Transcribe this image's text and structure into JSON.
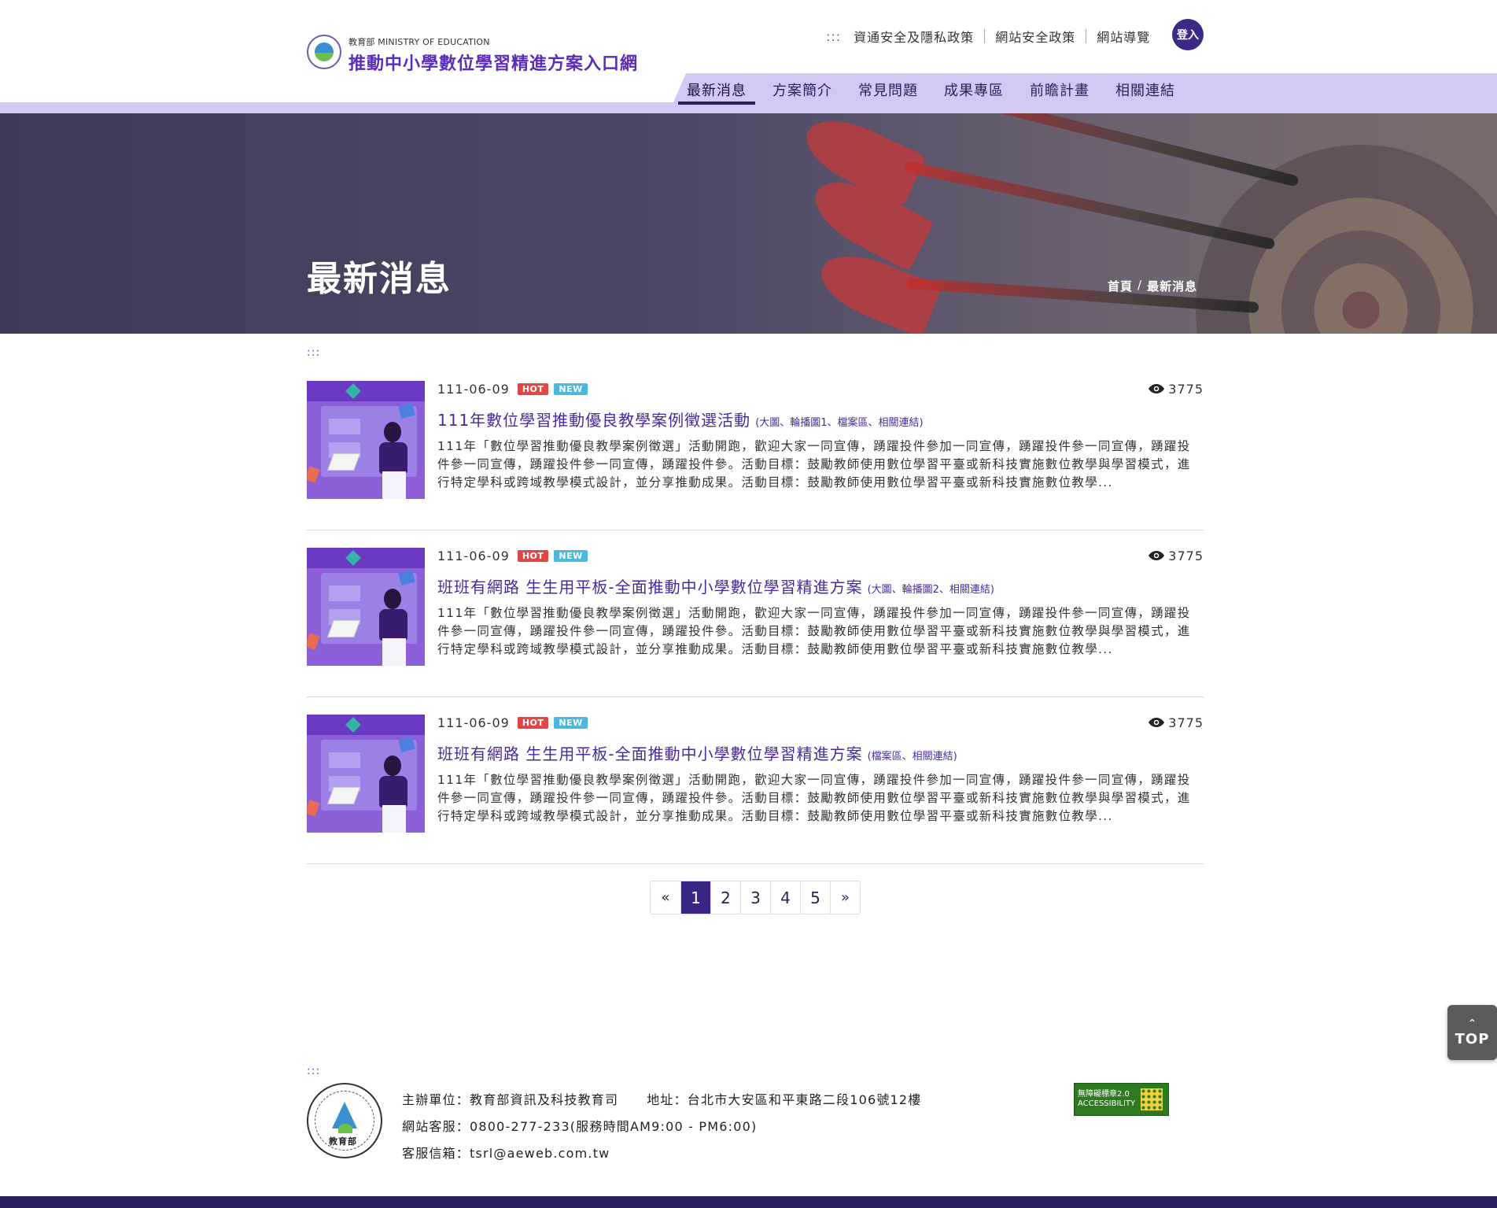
{
  "header": {
    "ministry": "教育部 MINISTRY OF EDUCATION",
    "site_title": "推動中小學數位學習精進方案入口網",
    "util_dots": ":::",
    "util_links": [
      "資通安全及隱私政策",
      "網站安全政策",
      "網站導覽"
    ],
    "login": "登入",
    "nav": [
      "最新消息",
      "方案簡介",
      "常見問題",
      "成果專區",
      "前瞻計畫",
      "相關連結"
    ],
    "active_nav": "最新消息"
  },
  "banner": {
    "title": "最新消息",
    "breadcrumb": [
      "首頁",
      "最新消息"
    ],
    "breadcrumb_sep": "/"
  },
  "content_dots": ":::",
  "news": [
    {
      "date": "111-06-09",
      "hot": "HOT",
      "new": "NEW",
      "views": "3775",
      "title": "111年數位學習推動優良教學案例徵選活動",
      "tags": "(大圖、輪播圖1、檔案區、相關連結)",
      "summary": "111年「數位學習推動優良教學案例徵選」活動開跑，歡迎大家一同宣傳，踴躍投件參加一同宣傳，踴躍投件參一同宣傳，踴躍投件參一同宣傳，踴躍投件參一同宣傳，踴躍投件參。活動目標：鼓勵教師使用數位學習平臺或新科技實施數位教學與學習模式，進行特定學科或跨域教學模式設計，並分享推動成果。活動目標：鼓勵教師使用數位學習平臺或新科技實施數位教學..."
    },
    {
      "date": "111-06-09",
      "hot": "HOT",
      "new": "NEW",
      "views": "3775",
      "title": "班班有網路 生生用平板-全面推動中小學數位學習精進方案",
      "tags": "(大圖、輪播圖2、相關連結)",
      "summary": "111年「數位學習推動優良教學案例徵選」活動開跑，歡迎大家一同宣傳，踴躍投件參加一同宣傳，踴躍投件參一同宣傳，踴躍投件參一同宣傳，踴躍投件參一同宣傳，踴躍投件參。活動目標：鼓勵教師使用數位學習平臺或新科技實施數位教學與學習模式，進行特定學科或跨域教學模式設計，並分享推動成果。活動目標：鼓勵教師使用數位學習平臺或新科技實施數位教學..."
    },
    {
      "date": "111-06-09",
      "hot": "HOT",
      "new": "NEW",
      "views": "3775",
      "title": "班班有網路 生生用平板-全面推動中小學數位學習精進方案",
      "tags": "(檔案區、相關連結)",
      "summary": "111年「數位學習推動優良教學案例徵選」活動開跑，歡迎大家一同宣傳，踴躍投件參加一同宣傳，踴躍投件參一同宣傳，踴躍投件參一同宣傳，踴躍投件參一同宣傳，踴躍投件參。活動目標：鼓勵教師使用數位學習平臺或新科技實施數位教學與學習模式，進行特定學科或跨域教學模式設計，並分享推動成果。活動目標：鼓勵教師使用數位學習平臺或新科技實施數位教學..."
    }
  ],
  "pagination": {
    "prev": "«",
    "pages": [
      "1",
      "2",
      "3",
      "4",
      "5"
    ],
    "current": "1",
    "next": "»"
  },
  "top_button": {
    "chevron": "⌃",
    "label": "TOP"
  },
  "footer": {
    "dots": ":::",
    "logo_cn": "教育部",
    "logo_ring": "MINISTRY OF EDUCATION",
    "organizer": "主辦單位：教育部資訊及科技教育司",
    "address": "地址：台北市大安區和平東路二段106號12樓",
    "phone": "網站客服：0800-277-233(服務時間AM9:00 - PM6:00)",
    "email": "客服信箱：tsrl@aeweb.com.tw",
    "accessibility": "無障礙標章2.0 ACCESSIBILITY"
  },
  "colors": {
    "brand_purple": "#5b2db8",
    "nav_lavender": "#d4c7f4",
    "dark_indigo": "#2a1f5c",
    "hot": "#e14646",
    "new": "#4bb8de"
  }
}
